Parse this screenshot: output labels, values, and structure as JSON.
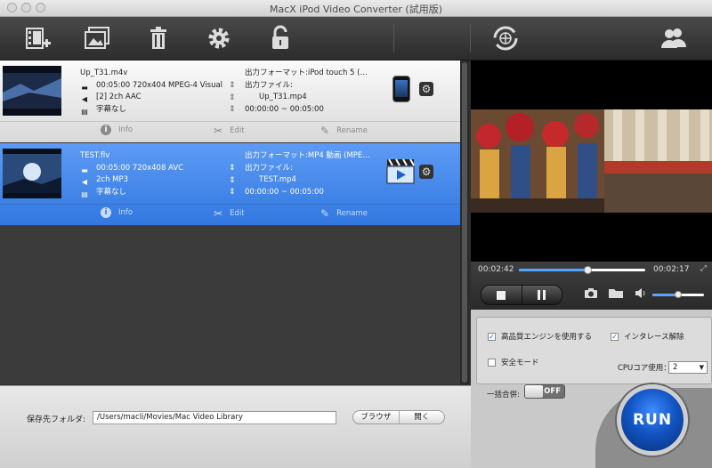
{
  "window": {
    "title": "MacX iPod Video Converter (試用版)"
  },
  "files": [
    {
      "name": "Up_T31.m4v",
      "video": "00:05:00 720x404 MPEG-4 Visual",
      "audio": "[2] 2ch AAC",
      "subtitle": "字幕なし",
      "output_format": "出力フォーマット:iPod touch 5 (…",
      "output_file_label": "出力ファイル:",
      "output_file": "Up_T31.mp4",
      "range": "00:00:00 ~ 00:05:00",
      "device": "ipod-icon"
    },
    {
      "name": "TEST.flv",
      "video": "00:05:00 720x408 AVC",
      "audio": "2ch MP3",
      "subtitle": "字幕なし",
      "output_format": "出力フォーマット:MP4 動画 (MPE…",
      "output_file_label": "出力ファイル:",
      "output_file": "TEST.mp4",
      "range": "00:00:00 ~ 00:05:00",
      "device": "clapperboard-icon"
    }
  ],
  "row_actions": {
    "info": "Info",
    "edit": "Edit",
    "rename": "Rename"
  },
  "save": {
    "label": "保存先フォルダ:",
    "path": "/Users/macli/Movies/Mac Video Library",
    "browse": "ブラウザ",
    "open": "開く"
  },
  "player": {
    "elapsed": "00:02:42",
    "remaining": "00:02:17",
    "progress": 0.54,
    "volume": 0.5
  },
  "options": {
    "hq_engine": "高品質エンジンを使用する",
    "deinterlace": "インタレース解除",
    "safe_mode": "安全モード",
    "cpu_label": "CPUコア使用：",
    "cpu_value": "2",
    "merge_label": "一括合併:",
    "merge_state": "OFF",
    "hq_checked": true,
    "deinterlace_checked": true,
    "safe_checked": false
  },
  "run": {
    "label": "RUN"
  },
  "colors": {
    "selected_row": "#3d82e8",
    "accent": "#58a5ff",
    "run": "#1254c2"
  }
}
